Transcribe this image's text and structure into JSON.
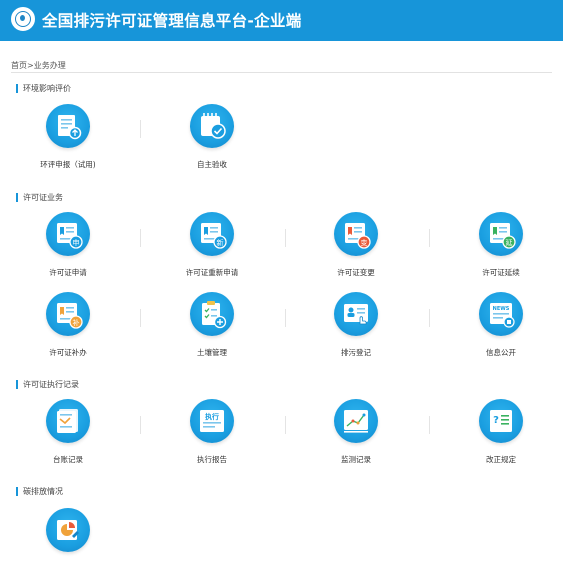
{
  "header": {
    "title": "全国排污许可证管理信息平台-企业端"
  },
  "breadcrumb": "首页>业务办理",
  "sections": [
    {
      "title": "环境影响评价",
      "tiles": [
        {
          "label": "环评申报（试用)",
          "icon": "document-upload-icon"
        },
        {
          "label": "自主验收",
          "icon": "notebook-check-icon"
        }
      ]
    },
    {
      "title": "许可证业务",
      "tiles": [
        {
          "label": "许可证申请",
          "icon": "certificate-apply-icon",
          "badge": "申",
          "badge_color": "#1a9ee0"
        },
        {
          "label": "许可证重新申请",
          "icon": "certificate-reapply-icon",
          "badge": "新",
          "badge_color": "#1a9ee0"
        },
        {
          "label": "许可证变更",
          "icon": "certificate-change-icon",
          "badge": "变",
          "badge_color": "#ea5b3a"
        },
        {
          "label": "许可证延续",
          "icon": "certificate-renew-icon",
          "badge": "延",
          "badge_color": "#3ab25f"
        },
        {
          "label": "许可证补办",
          "icon": "certificate-reissue-icon",
          "badge": "补",
          "badge_color": "#f0a23a"
        },
        {
          "label": "土壤管理",
          "icon": "clipboard-add-icon"
        },
        {
          "label": "排污登记",
          "icon": "registration-card-icon"
        },
        {
          "label": "信息公开",
          "icon": "news-icon",
          "badge": "NEWS"
        }
      ]
    },
    {
      "title": "许可证执行记录",
      "tiles": [
        {
          "label": "台账记录",
          "icon": "ledger-icon"
        },
        {
          "label": "执行报告",
          "icon": "execution-report-icon",
          "badge": "执行"
        },
        {
          "label": "监测记录",
          "icon": "monitoring-chart-icon"
        },
        {
          "label": "改正规定",
          "icon": "correction-question-icon"
        }
      ]
    },
    {
      "title": "碳排放情况",
      "tiles": [
        {
          "label": "",
          "icon": "carbon-emission-icon"
        }
      ]
    }
  ]
}
